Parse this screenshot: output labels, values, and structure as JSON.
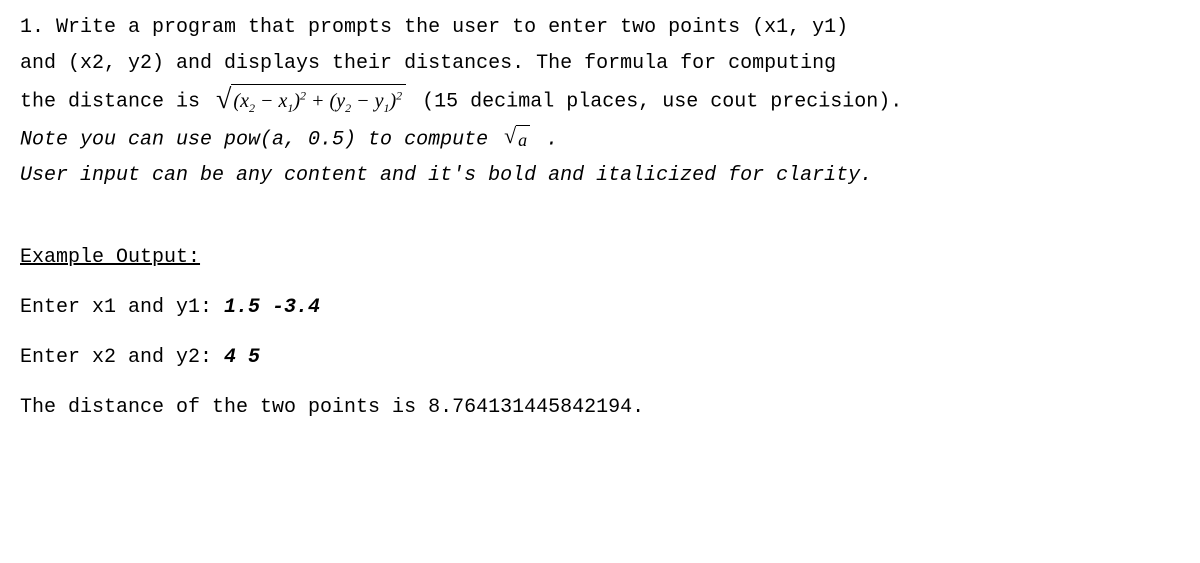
{
  "problem": {
    "line1a": "1. Write a program that prompts the user to enter two points (x1, y1)",
    "line1b": "and (x2, y2) and displays their distances. The formula for computing",
    "line2_prefix": "the distance is ",
    "line2_suffix": " (15 decimal places, use cout precision).",
    "note_prefix": "Note you can use pow(a, 0.5) to compute ",
    "note_suffix": " .",
    "user_input_note": "User input can be any content and it's bold and italicized for clarity."
  },
  "formula": {
    "x2": "x",
    "x2_sub": "2",
    "minus1": " − ",
    "x1": "x",
    "x1_sub": "1",
    "sq1": "2",
    "plus": " + ",
    "y2": "y",
    "y2_sub": "2",
    "minus2": " − ",
    "y1": "y",
    "y1_sub": "1",
    "sq2": "2"
  },
  "sqrt_a": {
    "a": "a"
  },
  "example": {
    "heading": "Example Output:",
    "prompt1": "Enter x1 and y1: ",
    "input1": "1.5 -3.4",
    "prompt2": "Enter x2 and y2: ",
    "input2": "4 5",
    "result": "The distance of the two points is 8.764131445842194."
  }
}
